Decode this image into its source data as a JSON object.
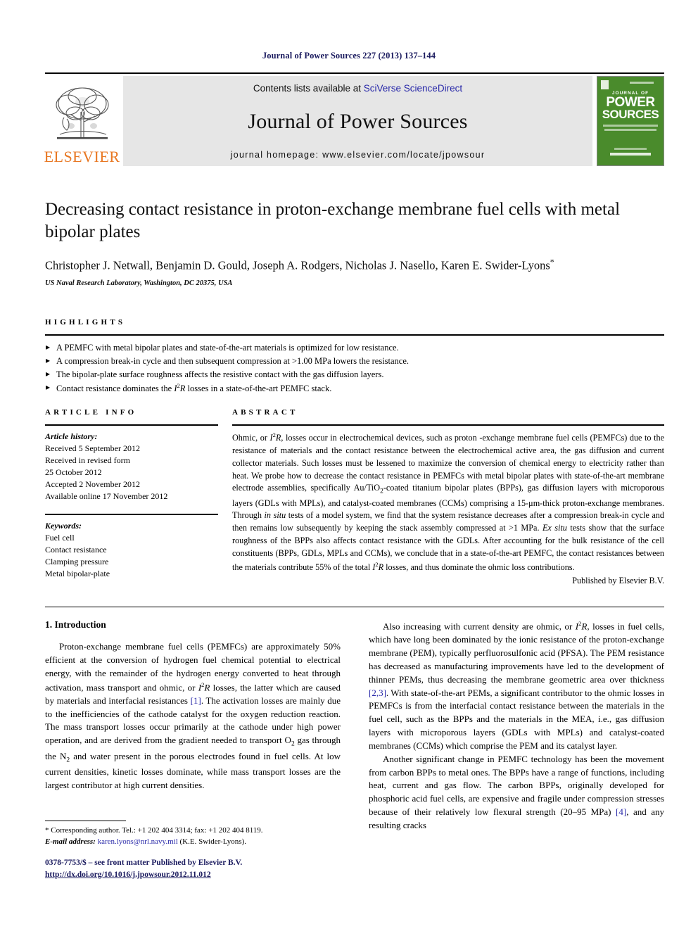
{
  "running_head": "Journal of Power Sources 227 (2013) 137–144",
  "masthead": {
    "contents_prefix": "Contents lists available at ",
    "sciencedirect": "SciVerse ScienceDirect",
    "journal_name": "Journal of Power Sources",
    "homepage": "journal homepage: www.elsevier.com/locate/jpowsour",
    "publisher_logo_text": "ELSEVIER",
    "cover": {
      "journal_of": "JOURNAL OF",
      "power": "POWER",
      "sources": "SOURCES"
    }
  },
  "article": {
    "title": "Decreasing contact resistance in proton-exchange membrane fuel cells with metal bipolar plates",
    "authors": "Christopher J. Netwall, Benjamin D. Gould, Joseph A. Rodgers, Nicholas J. Nasello, Karen E. Swider-Lyons",
    "corresponding_marker": "*",
    "affiliation": "US Naval Research Laboratory, Washington, DC 20375, USA"
  },
  "highlights": {
    "label": "HIGHLIGHTS",
    "items": [
      "A PEMFC with metal bipolar plates and state-of-the-art materials is optimized for low resistance.",
      "A compression break-in cycle and then subsequent compression at >1.00 MPa lowers the resistance.",
      "The bipolar-plate surface roughness affects the resistive contact with the gas diffusion layers.",
      "Contact resistance dominates the I2R losses in a state-of-the-art PEMFC stack."
    ],
    "item4_pre": "Contact resistance dominates the ",
    "item4_i": "I",
    "item4_sup": "2",
    "item4_r": "R",
    "item4_post": " losses in a state-of-the-art PEMFC stack."
  },
  "article_info": {
    "label": "ARTICLE INFO",
    "history_heading": "Article history:",
    "history_lines": [
      "Received 5 September 2012",
      "Received in revised form",
      "25 October 2012",
      "Accepted 2 November 2012",
      "Available online 17 November 2012"
    ],
    "keywords_heading": "Keywords:",
    "keywords": [
      "Fuel cell",
      "Contact resistance",
      "Clamping pressure",
      "Metal bipolar-plate"
    ]
  },
  "abstract": {
    "label": "ABSTRACT",
    "p1_a": "Ohmic, or ",
    "p1_i": "I",
    "p1_sup": "2",
    "p1_r": "R",
    "p1_b": ", losses occur in electrochemical devices, such as proton -exchange membrane fuel cells (PEMFCs) due to the resistance of materials and the contact resistance between the electrochemical active area, the gas diffusion and current collector materials. Such losses must be lessened to maximize the conversion of chemical energy to electricity rather than heat. We probe how to decrease the contact resistance in PEMFCs with metal bipolar plates with state-of-the-art membrane electrode assemblies, specifically Au/TiO",
    "p1_sub": "2",
    "p1_c": "-coated titanium bipolar plates (BPPs), gas diffusion layers with microporous layers (GDLs with MPLs), and catalyst-coated membranes (CCMs) comprising a 15-μm-thick proton-exchange membranes. Through ",
    "p1_insitu": "in situ",
    "p1_d": " tests of a model system, we find that the system resistance decreases after a compression break-in cycle and then remains low subsequently by keeping the stack assembly compressed at >1 MPa. ",
    "p1_exsitu": "Ex situ",
    "p1_e": " tests show that the surface roughness of the BPPs also affects contact resistance with the GDLs. After accounting for the bulk resistance of the cell constituents (BPPs, GDLs, MPLs and CCMs), we conclude that in a state-of-the-art PEMFC, the contact resistances between the materials contribute 55% of the total ",
    "p1_i2": "I",
    "p1_sup2": "2",
    "p1_r2": "R",
    "p1_f": " losses, and thus dominate the ohmic loss contributions.",
    "published_by": "Published by Elsevier B.V."
  },
  "body": {
    "section_number_title": "1. Introduction",
    "left_p1_a": "Proton-exchange membrane fuel cells (PEMFCs) are approximately 50% efficient at the conversion of hydrogen fuel chemical potential to electrical energy, with the remainder of the hydrogen energy converted to heat through activation, mass transport and ohmic, or ",
    "left_p1_i": "I",
    "left_p1_sup": "2",
    "left_p1_r": "R",
    "left_p1_b": " losses, the latter which are caused by materials and interfacial resistances ",
    "left_p1_ref": "[1]",
    "left_p1_c": ". The activation losses are mainly due to the inefficiencies of the cathode catalyst for the oxygen reduction reaction. The mass transport losses occur primarily at the cathode under high power operation, and are derived from the gradient needed to transport O",
    "left_p1_sub1": "2",
    "left_p1_d": " gas through the N",
    "left_p1_sub2": "2",
    "left_p1_e": " and water present in the porous electrodes found in fuel cells. At low current densities, kinetic losses dominate, while mass transport losses are the largest contributor at high current densities.",
    "right_p1_a": "Also increasing with current density are ohmic, or ",
    "right_p1_i": "I",
    "right_p1_sup": "2",
    "right_p1_r": "R",
    "right_p1_b": ", losses in fuel cells, which have long been dominated by the ionic resistance of the proton-exchange membrane (PEM), typically perfluorosulfonic acid (PFSA). The PEM resistance has decreased as manufacturing improvements have led to the development of thinner PEMs, thus decreasing the membrane geometric area over thickness ",
    "right_p1_ref": "[2,3]",
    "right_p1_c": ". With state-of-the-art PEMs, a significant contributor to the ohmic losses in PEMFCs is from the interfacial contact resistance between the materials in the fuel cell, such as the BPPs and the materials in the MEA, i.e., gas diffusion layers with microporous layers (GDLs with MPLs) and catalyst-coated membranes (CCMs) which comprise the PEM and its catalyst layer.",
    "right_p2_a": "Another significant change in PEMFC technology has been the movement from carbon BPPs to metal ones. The BPPs have a range of functions, including heat, current and gas flow. The carbon BPPs, originally developed for phosphoric acid fuel cells, are expensive and fragile under compression stresses because of their relatively low flexural strength (20–95 MPa) ",
    "right_p2_ref": "[4]",
    "right_p2_b": ", and any resulting cracks"
  },
  "footnote": {
    "corresponding": "* Corresponding author. Tel.: +1 202 404 3314; fax: +1 202 404 8119.",
    "email_label": "E-mail address:",
    "email": "karen.lyons@nrl.navy.mil",
    "email_suffix": "(K.E. Swider-Lyons)."
  },
  "copyright": {
    "line1": "0378-7753/$ – see front matter Published by Elsevier B.V.",
    "doi": "http://dx.doi.org/10.1016/j.jpowsour.2012.11.012"
  }
}
